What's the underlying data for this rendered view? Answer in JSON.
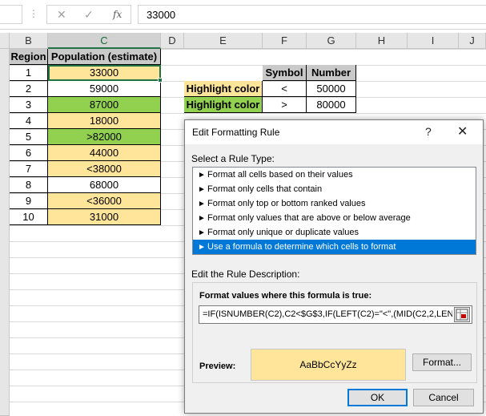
{
  "formula_bar": {
    "value": "33000",
    "cancel_icon": "✕",
    "enter_icon": "✓",
    "fx_icon": "fx"
  },
  "columns": [
    "B",
    "C",
    "D",
    "E",
    "F",
    "G",
    "H",
    "I",
    "J"
  ],
  "table1": {
    "headers": [
      "Region",
      "Population (estimate)"
    ],
    "rows": [
      {
        "region": "1",
        "pop": "33000"
      },
      {
        "region": "2",
        "pop": "59000"
      },
      {
        "region": "3",
        "pop": "87000"
      },
      {
        "region": "4",
        "pop": "18000"
      },
      {
        "region": "5",
        "pop": ">82000"
      },
      {
        "region": "6",
        "pop": "44000"
      },
      {
        "region": "7",
        "pop": "<38000"
      },
      {
        "region": "8",
        "pop": "68000"
      },
      {
        "region": "9",
        "pop": "<36000"
      },
      {
        "region": "10",
        "pop": "31000"
      }
    ],
    "colors": {
      "yellow": "#ffe599",
      "green": "#92d050",
      "white": "#ffffff"
    }
  },
  "table2": {
    "headers": [
      "Symbol",
      "Number"
    ],
    "rows": [
      {
        "label": "Highlight color",
        "symbol": "<",
        "number": "50000"
      },
      {
        "label": "Highlight color",
        "symbol": ">",
        "number": "80000"
      }
    ]
  },
  "dialog": {
    "title": "Edit Formatting Rule",
    "help": "?",
    "close": "✕",
    "select_label": "Select a Rule Type:",
    "rules": [
      "Format all cells based on their values",
      "Format only cells that contain",
      "Format only top or bottom ranked values",
      "Format only values that are above or below average",
      "Format only unique or duplicate values",
      "Use a formula to determine which cells to format"
    ],
    "edit_label": "Edit the Rule Description:",
    "formula_label": "Format values where this formula is true:",
    "formula": "=IF(ISNUMBER(C2),C2<$G$3,IF(LEFT(C2)=\"<\",(MID(C2,2,LEN(C2",
    "preview_label": "Preview:",
    "preview_text": "AaBbCcYyZz",
    "format_btn": "Format...",
    "ok_btn": "OK",
    "cancel_btn": "Cancel",
    "selected_color": "#0078d7"
  }
}
